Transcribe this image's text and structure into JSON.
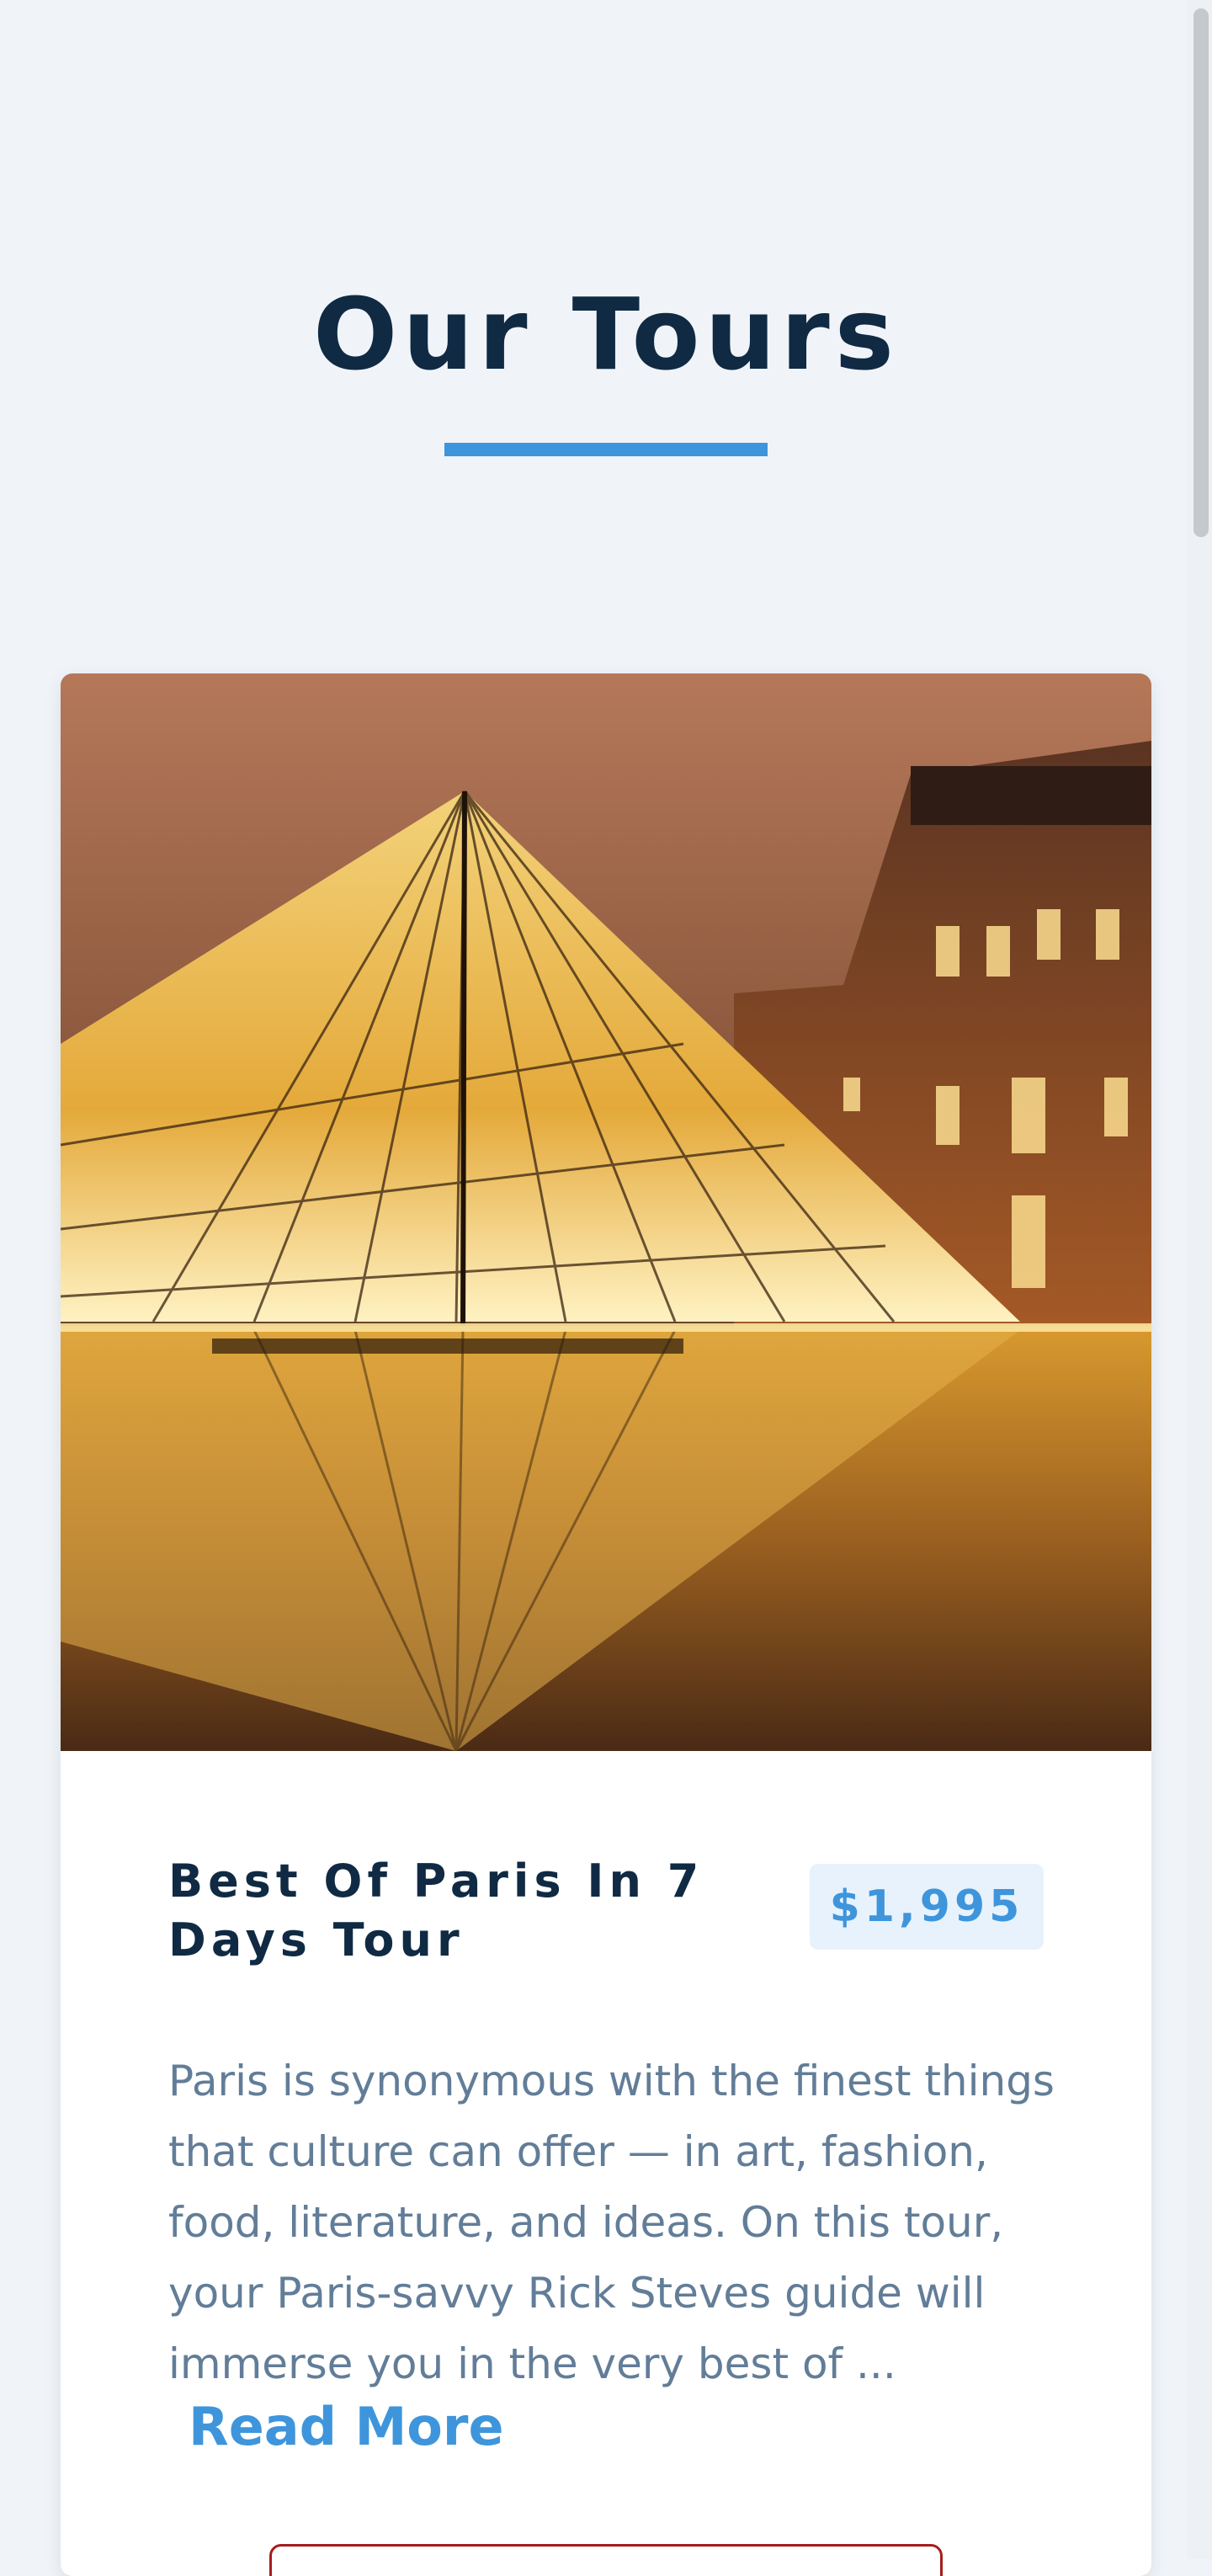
{
  "page": {
    "title": "Our Tours"
  },
  "tours": [
    {
      "name": "Best Of Paris In 7 Days Tour",
      "price": "$1,995",
      "description": "Paris is synonymous with the finest things that culture can offer — in art, fashion, food, literature, and ideas. On this tour, your Paris-savvy Rick Steves guide will immerse you in the very best of ...",
      "read_more_label": "Read More",
      "image_subject": "Louvre pyramid at night"
    }
  ],
  "colors": {
    "background": "#f0f4f8",
    "title": "#102a43",
    "accent": "#3e95dc",
    "price_bg": "#e8f2fc",
    "body_text": "#627d98",
    "danger_border": "#a51d1d",
    "card_bg": "#ffffff"
  }
}
